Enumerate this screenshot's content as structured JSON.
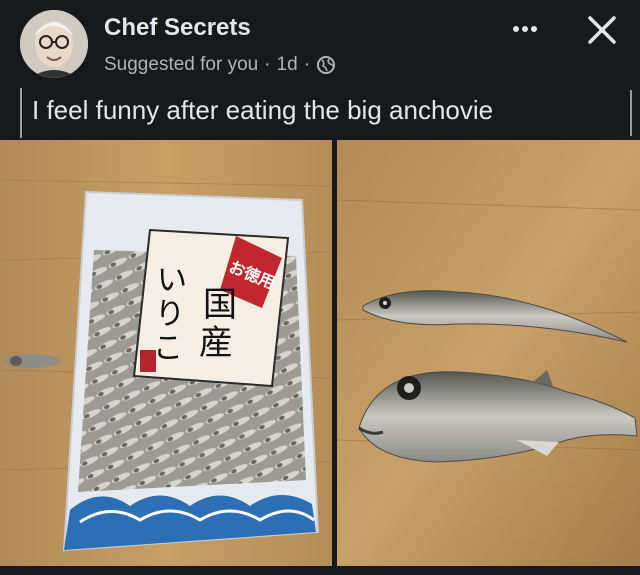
{
  "post": {
    "author": "Chef Secrets",
    "suggested": "Suggested for you",
    "dot": "·",
    "time": "1d",
    "caption": "I feel funny after eating the big anchovie"
  },
  "package": {
    "label_tag": "お徳用",
    "label_main_1": "国",
    "label_main_2": "産",
    "label_side_1": "い",
    "label_side_2": "り",
    "label_side_3": "こ"
  },
  "icons": {
    "more": "more-options-icon",
    "close": "close-icon",
    "privacy": "globe-icon"
  }
}
